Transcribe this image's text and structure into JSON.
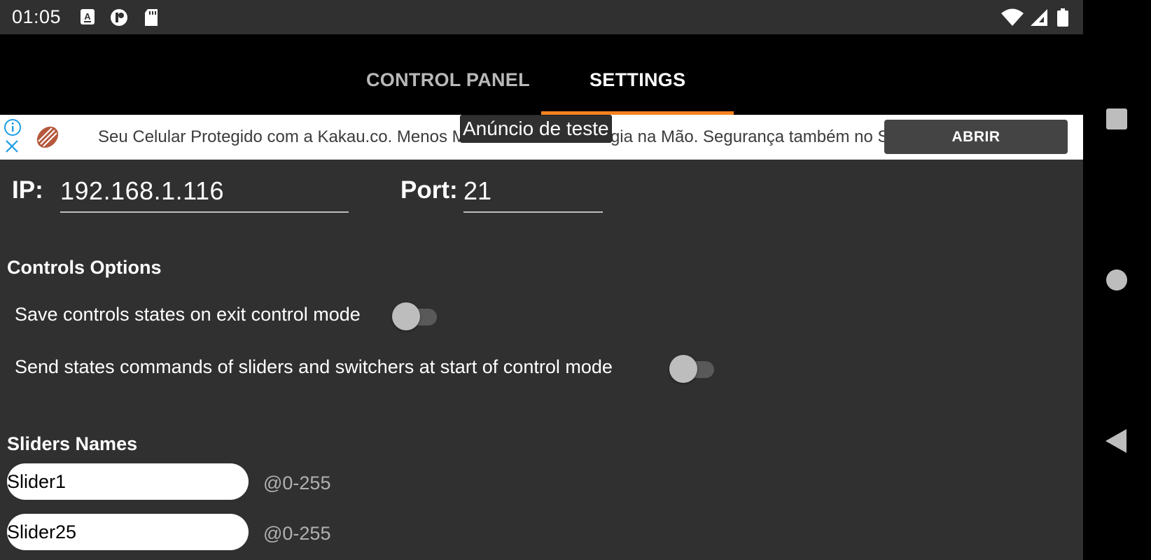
{
  "status_bar": {
    "time": "01:05",
    "left_icons": [
      "a-keyboard-icon",
      "p-app-icon",
      "sd-card-icon"
    ],
    "right_icons": [
      "wifi-icon",
      "cell-signal-icon",
      "battery-icon"
    ]
  },
  "tabs": [
    {
      "label": "CONTROL PANEL",
      "selected": false
    },
    {
      "label": "SETTINGS",
      "selected": true
    }
  ],
  "colors": {
    "accent": "#f58220",
    "background": "#303030",
    "tab_bar": "#000000"
  },
  "ad": {
    "text": "Seu Celular Protegido com a Kakau.co. Menos Medo e Mais Tecnologia na Mão. Segurança também no Seu Bolso. Assine",
    "button_label": "ABRIR",
    "test_label": "Anúncio de teste"
  },
  "connection": {
    "ip_label": "IP:",
    "ip_value": "192.168.1.116",
    "port_label": "Port:",
    "port_value": "21"
  },
  "controls_options": {
    "title": "Controls Options",
    "options": [
      {
        "label": "Save controls states on exit control mode",
        "enabled": false
      },
      {
        "label": "Send states commands of sliders and switchers at start of control mode",
        "enabled": false
      }
    ]
  },
  "sliders_names": {
    "title": "Sliders Names",
    "items": [
      {
        "name": "Slider1",
        "range": "@0-255"
      },
      {
        "name": "Slider25",
        "range": "@0-255"
      }
    ]
  },
  "nav_bar": {
    "buttons": [
      "recents-button",
      "home-button",
      "back-button"
    ]
  }
}
